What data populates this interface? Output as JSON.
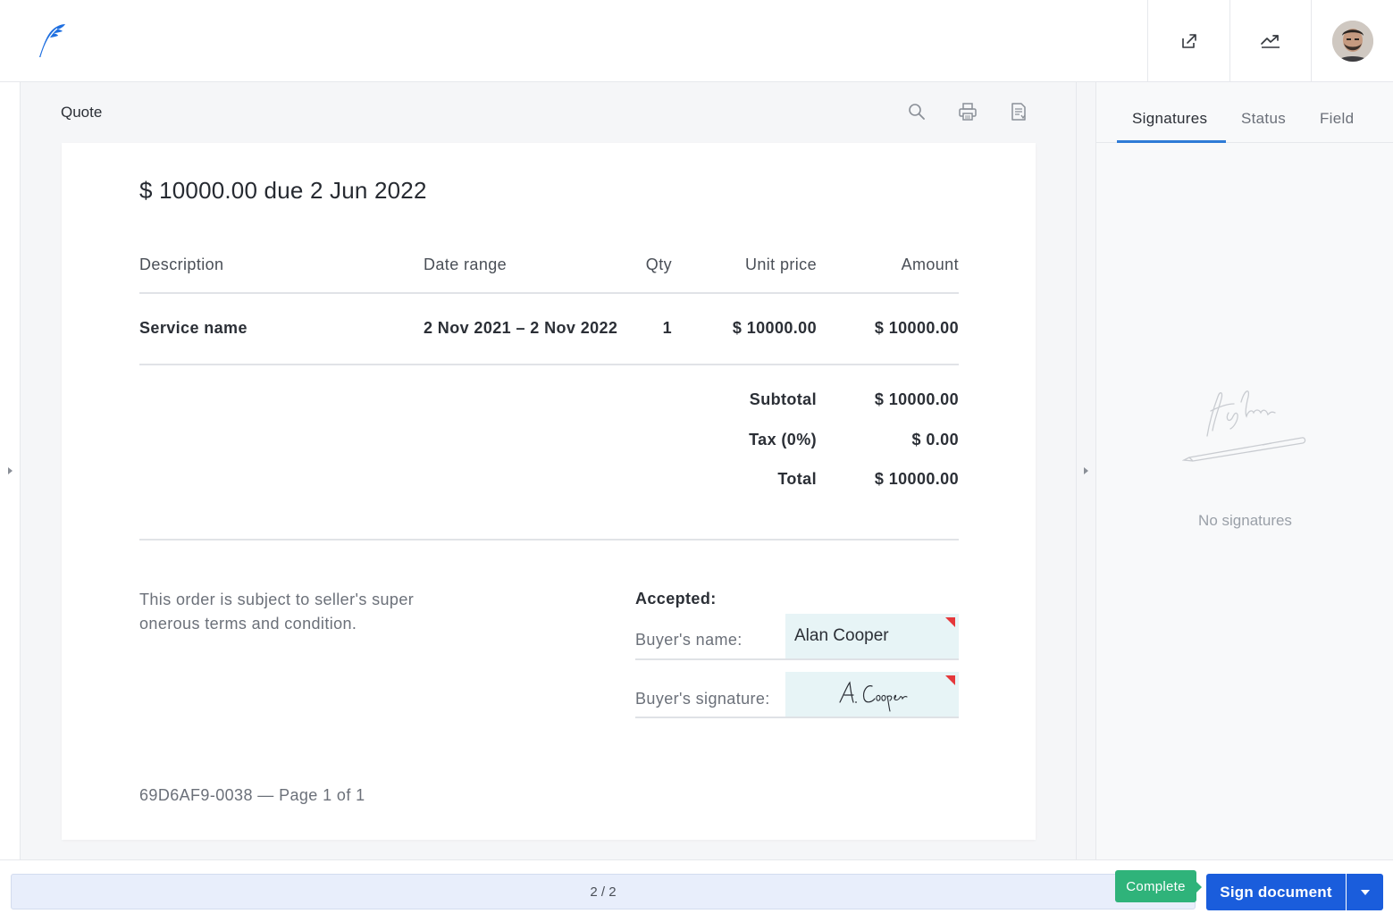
{
  "header": {
    "logo_icon": "feather-logo-icon",
    "share_icon": "share-icon",
    "stats_icon": "trending-icon",
    "avatar_icon": "user-avatar"
  },
  "document": {
    "title": "Quote",
    "tools": [
      "search-icon",
      "print-icon",
      "document-icon"
    ],
    "due_line": "$ 10000.00 due 2 Jun 2022",
    "table": {
      "headers": [
        "Description",
        "Date range",
        "Qty",
        "Unit price",
        "Amount"
      ],
      "rows": [
        [
          "Service name",
          "2 Nov 2021 – 2 Nov 2022",
          "1",
          "$ 10000.00",
          "$ 10000.00"
        ]
      ]
    },
    "summary": {
      "subtotal_label": "Subtotal",
      "subtotal_value": "$ 10000.00",
      "tax_label": "Tax (0%)",
      "tax_value": "$ 0.00",
      "total_label": "Total",
      "total_value": "$ 10000.00"
    },
    "terms_text": "This order is subject to seller's super onerous terms and condition.",
    "accepted": {
      "heading": "Accepted:",
      "buyer_name_label": "Buyer's name:",
      "buyer_name_value": "Alan Cooper",
      "buyer_signature_label": "Buyer's signature:"
    },
    "footer": "69D6AF9-0038 — Page 1 of 1"
  },
  "right_panel": {
    "tabs": [
      "Signatures",
      "Status",
      "Field"
    ],
    "active_tab": "Signatures",
    "empty_text": "No signatures"
  },
  "bottom": {
    "pager": "2 / 2",
    "complete_label": "Complete",
    "sign_label": "Sign document"
  },
  "colors": {
    "primary": "#1a5ddc",
    "success": "#2fb37a",
    "flag": "#e5383b",
    "field_bg": "#e7f4f6",
    "tab_accent": "#2e7bd6"
  }
}
